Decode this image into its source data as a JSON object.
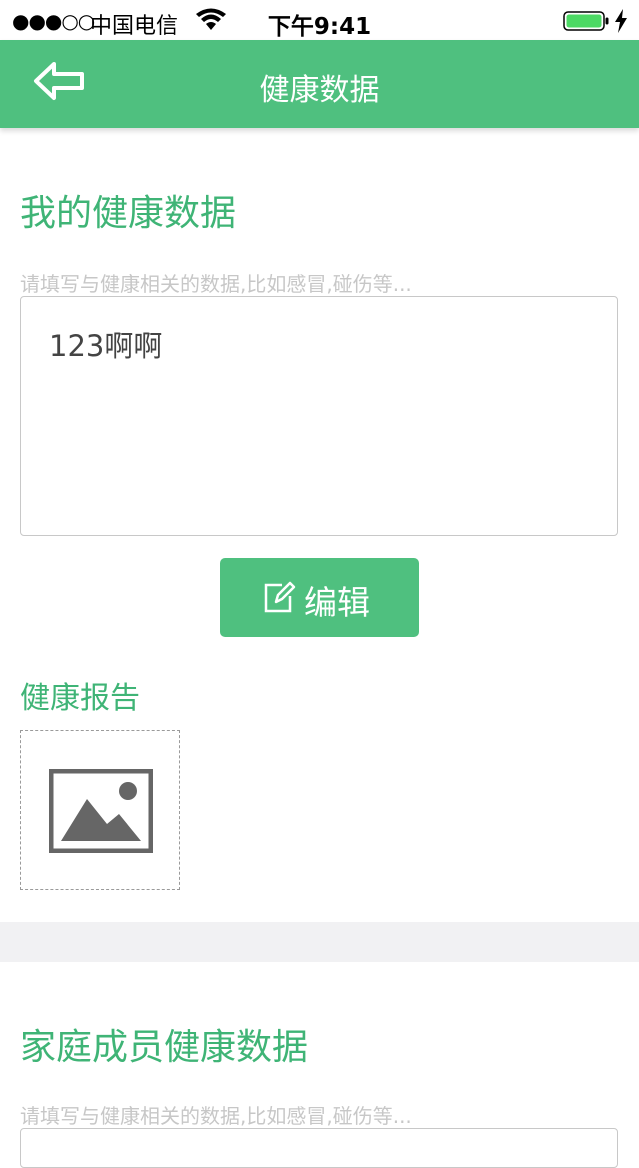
{
  "status_bar": {
    "signal": "●●●○○",
    "carrier": "中国电信",
    "time": "下午9:41"
  },
  "nav": {
    "title": "健康数据"
  },
  "my_health": {
    "title": "我的健康数据",
    "placeholder_hint": "请填写与健康相关的数据,比如感冒,碰伤等...",
    "value": "123啊啊",
    "edit_label": "编辑"
  },
  "report": {
    "title": "健康报告"
  },
  "family_health": {
    "title": "家庭成员健康数据",
    "placeholder_hint": "请填写与健康相关的数据,比如感冒,碰伤等..."
  },
  "colors": {
    "accent": "#4fc07f",
    "title_green": "#3fb476",
    "band": "#f1f1f3"
  }
}
